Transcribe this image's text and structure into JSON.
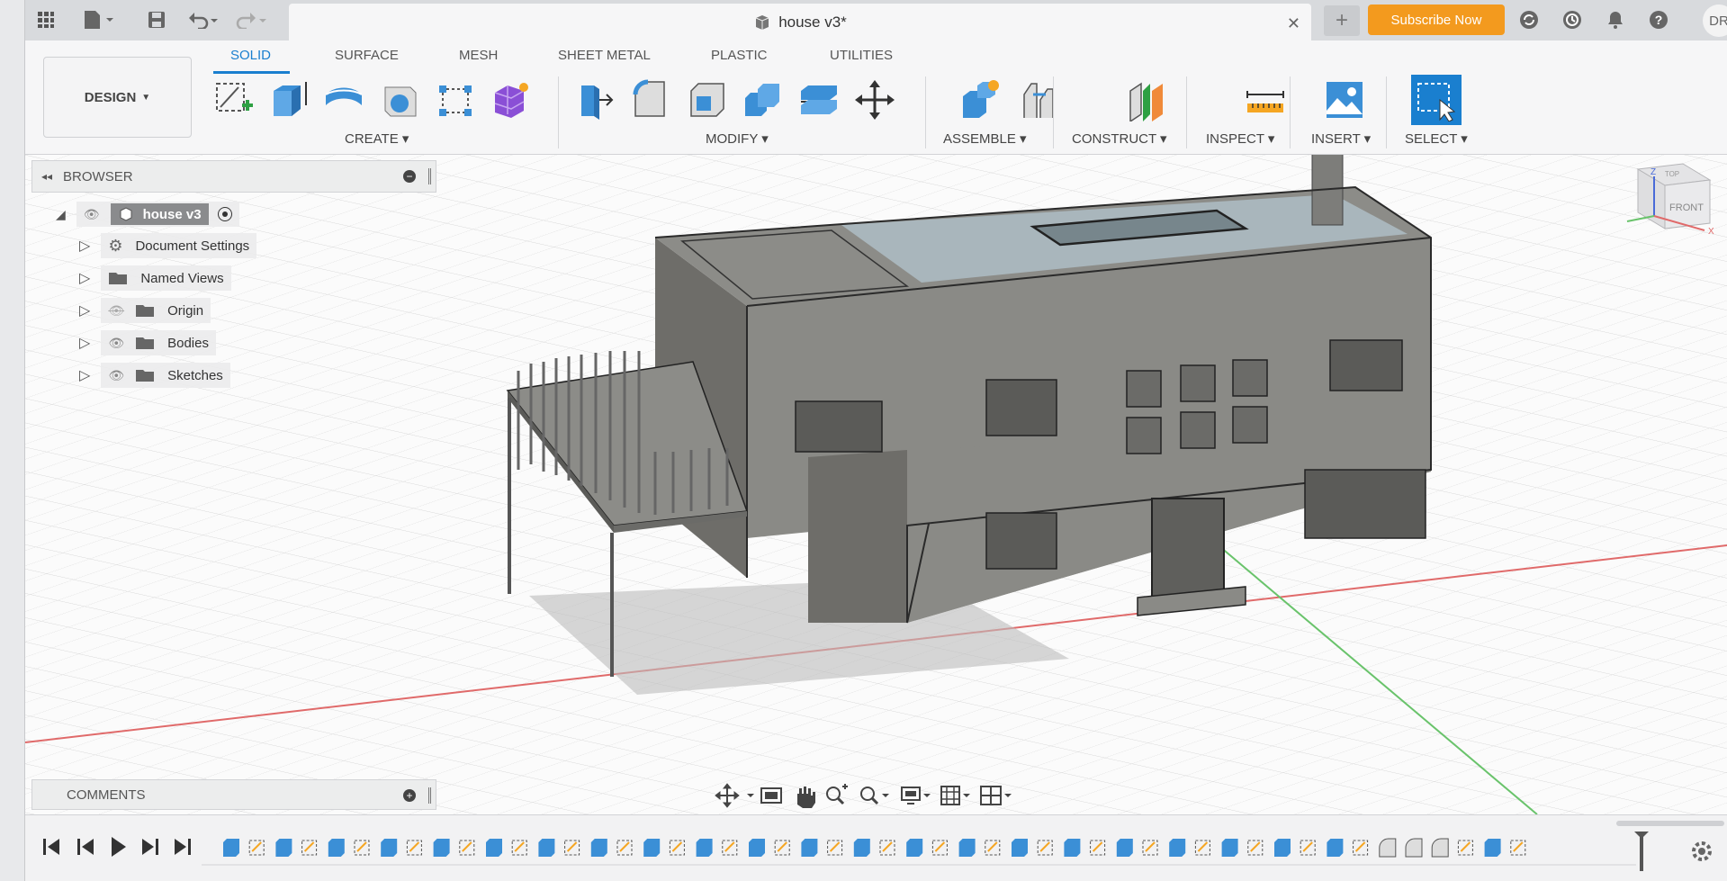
{
  "document": {
    "title": "house v3*"
  },
  "appbar": {
    "subscribe_label": "Subscribe Now",
    "user_initials": "DR"
  },
  "toolbar": {
    "workspace_label": "DESIGN",
    "tabs": [
      "SOLID",
      "SURFACE",
      "MESH",
      "SHEET METAL",
      "PLASTIC",
      "UTILITIES"
    ],
    "groups": [
      "CREATE",
      "MODIFY",
      "ASSEMBLE",
      "CONSTRUCT",
      "INSPECT",
      "INSERT",
      "SELECT"
    ]
  },
  "browser": {
    "title": "BROWSER",
    "root": "house v3",
    "items": [
      "Document Settings",
      "Named Views",
      "Origin",
      "Bodies",
      "Sketches"
    ]
  },
  "comments": {
    "title": "COMMENTS"
  },
  "viewcube": {
    "face_label": "FRONT",
    "top_label": "TOP"
  },
  "colors": {
    "accent": "#1a7fcf",
    "subscribe": "#f39a1e",
    "model_fill": "#8a8a86"
  }
}
